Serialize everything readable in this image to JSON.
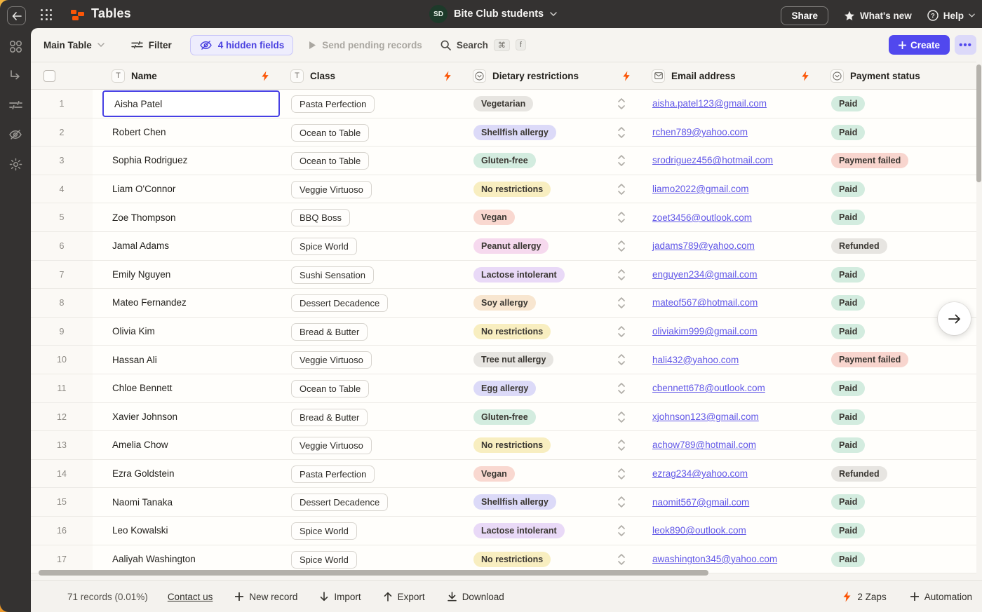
{
  "topbar": {
    "app_title": "Tables",
    "workspace_initials": "SD",
    "workspace_name": "Bite Club students",
    "share_label": "Share",
    "whats_new_label": "What's new",
    "help_label": "Help"
  },
  "toolbar": {
    "table_selector_label": "Main Table",
    "filter_label": "Filter",
    "hidden_fields_label": "4 hidden fields",
    "send_pending_label": "Send pending records",
    "search_label": "Search",
    "search_key_1": "⌘",
    "search_key_2": "f",
    "create_label": "Create",
    "more_label": "•••"
  },
  "sidebar": {
    "items": [
      "apps-grid",
      "arrow-branch",
      "filters",
      "hidden-fields",
      "settings"
    ]
  },
  "table": {
    "columns": [
      {
        "label": "Name",
        "type": "text",
        "synced": true
      },
      {
        "label": "Class",
        "type": "text",
        "synced": true
      },
      {
        "label": "Dietary restrictions",
        "type": "select",
        "synced": true
      },
      {
        "label": "Email address",
        "type": "email",
        "synced": true
      },
      {
        "label": "Payment status",
        "type": "select",
        "synced": false
      }
    ],
    "rows": [
      {
        "num": "1",
        "name": "Aisha Patel",
        "class": "Pasta Perfection",
        "dietary": "Vegetarian",
        "dietary_color": "gray",
        "email": "aisha.patel123@gmail.com",
        "status": "Paid",
        "status_color": "green",
        "selected": true
      },
      {
        "num": "2",
        "name": "Robert Chen",
        "class": "Ocean to Table",
        "dietary": "Shellfish allergy",
        "dietary_color": "periwinkle",
        "email": "rchen789@yahoo.com",
        "status": "Paid",
        "status_color": "green"
      },
      {
        "num": "3",
        "name": "Sophia Rodriguez",
        "class": "Ocean to Table",
        "dietary": "Gluten-free",
        "dietary_color": "green",
        "email": "srodriguez456@hotmail.com",
        "status": "Payment failed",
        "status_color": "red"
      },
      {
        "num": "4",
        "name": "Liam O'Connor",
        "class": "Veggie Virtuoso",
        "dietary": "No restrictions",
        "dietary_color": "yellow",
        "email": "liamo2022@gmail.com",
        "status": "Paid",
        "status_color": "green"
      },
      {
        "num": "5",
        "name": "Zoe Thompson",
        "class": "BBQ Boss",
        "dietary": "Vegan",
        "dietary_color": "salmon",
        "email": "zoet3456@outlook.com",
        "status": "Paid",
        "status_color": "green"
      },
      {
        "num": "6",
        "name": "Jamal Adams",
        "class": "Spice World",
        "dietary": "Peanut allergy",
        "dietary_color": "pink",
        "email": "jadams789@yahoo.com",
        "status": "Refunded",
        "status_color": "gray"
      },
      {
        "num": "7",
        "name": "Emily Nguyen",
        "class": "Sushi Sensation",
        "dietary": "Lactose intolerant",
        "dietary_color": "purple",
        "email": "enguyen234@gmail.com",
        "status": "Paid",
        "status_color": "green"
      },
      {
        "num": "8",
        "name": "Mateo Fernandez",
        "class": "Dessert Decadence",
        "dietary": "Soy allergy",
        "dietary_color": "peach",
        "email": "mateof567@hotmail.com",
        "status": "Paid",
        "status_color": "green"
      },
      {
        "num": "9",
        "name": "Olivia Kim",
        "class": "Bread & Butter",
        "dietary": "No restrictions",
        "dietary_color": "yellow",
        "email": "oliviakim999@gmail.com",
        "status": "Paid",
        "status_color": "green"
      },
      {
        "num": "10",
        "name": "Hassan Ali",
        "class": "Veggie Virtuoso",
        "dietary": "Tree nut allergy",
        "dietary_color": "gray",
        "email": "hali432@yahoo.com",
        "status": "Payment failed",
        "status_color": "red"
      },
      {
        "num": "11",
        "name": "Chloe Bennett",
        "class": "Ocean to Table",
        "dietary": "Egg allergy",
        "dietary_color": "periwinkle",
        "email": "cbennett678@outlook.com",
        "status": "Paid",
        "status_color": "green"
      },
      {
        "num": "12",
        "name": "Xavier Johnson",
        "class": "Bread & Butter",
        "dietary": "Gluten-free",
        "dietary_color": "green",
        "email": "xjohnson123@gmail.com",
        "status": "Paid",
        "status_color": "green"
      },
      {
        "num": "13",
        "name": "Amelia Chow",
        "class": "Veggie Virtuoso",
        "dietary": "No restrictions",
        "dietary_color": "yellow",
        "email": "achow789@hotmail.com",
        "status": "Paid",
        "status_color": "green"
      },
      {
        "num": "14",
        "name": "Ezra Goldstein",
        "class": "Pasta Perfection",
        "dietary": "Vegan",
        "dietary_color": "salmon",
        "email": "ezrag234@yahoo.com",
        "status": "Refunded",
        "status_color": "gray"
      },
      {
        "num": "15",
        "name": "Naomi Tanaka",
        "class": "Dessert Decadence",
        "dietary": "Shellfish allergy",
        "dietary_color": "periwinkle",
        "email": "naomit567@gmail.com",
        "status": "Paid",
        "status_color": "green"
      },
      {
        "num": "16",
        "name": "Leo Kowalski",
        "class": "Spice World",
        "dietary": "Lactose intolerant",
        "dietary_color": "purple",
        "email": "leok890@outlook.com",
        "status": "Paid",
        "status_color": "green"
      },
      {
        "num": "17",
        "name": "Aaliyah Washington",
        "class": "Spice World",
        "dietary": "No restrictions",
        "dietary_color": "yellow",
        "email": "awashington345@yahoo.com",
        "status": "Paid",
        "status_color": "green"
      }
    ]
  },
  "footer": {
    "records_label": "71 records (0.01%)",
    "contact_label": "Contact us",
    "new_record_label": "New record",
    "import_label": "Import",
    "export_label": "Export",
    "download_label": "Download",
    "zaps_label": "2 Zaps",
    "automation_label": "Automation"
  },
  "colors": {
    "accent": "#5148ee",
    "brand_orange": "#fb5607",
    "pill_gray": "#e7e5e1",
    "pill_periwinkle": "#dcdaf8",
    "pill_green": "#d3ecdf",
    "pill_yellow": "#f8eec0",
    "pill_salmon": "#f9d8d0",
    "pill_pink": "#f6d9ee",
    "pill_purple": "#e9d9f7",
    "pill_peach": "#f8e6d0",
    "pill_red": "#f8d5ce"
  }
}
